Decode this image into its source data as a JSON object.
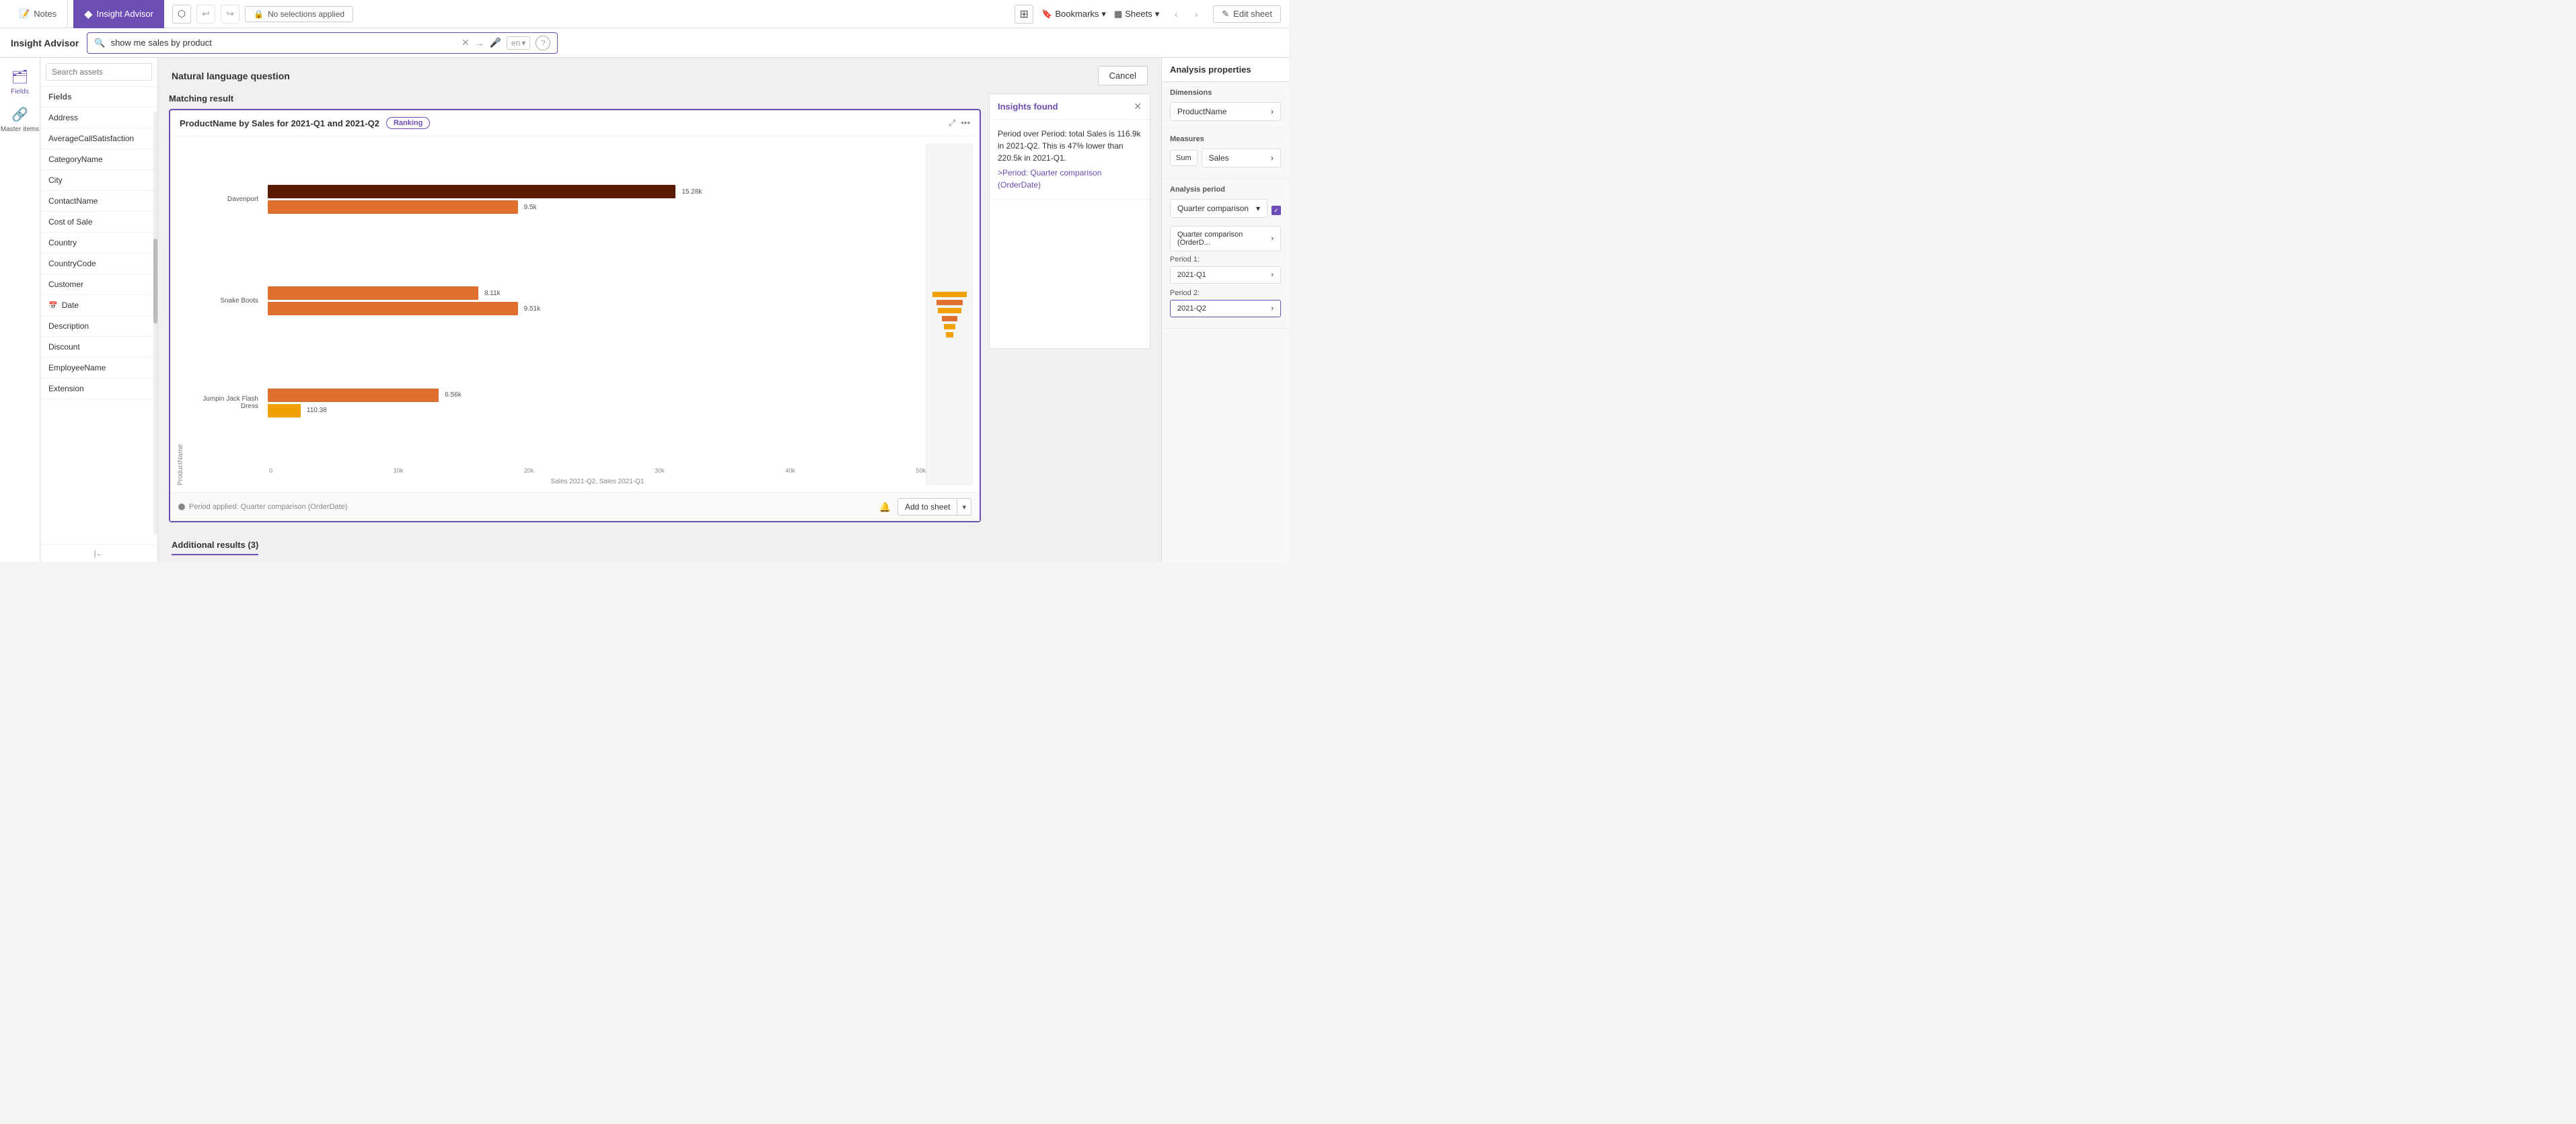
{
  "tabs": {
    "notes": "Notes",
    "insight_advisor": "Insight Advisor"
  },
  "top_bar": {
    "no_selections": "No selections applied",
    "bookmarks": "Bookmarks",
    "sheets": "Sheets",
    "edit_sheet": "Edit sheet"
  },
  "sub_header": {
    "title": "Insight Advisor",
    "search_value": "show me sales by product",
    "lang": "en",
    "lang_arrow": "▾"
  },
  "sidebar": {
    "fields_label": "Fields",
    "master_items_label": "Master items"
  },
  "fields_panel": {
    "search_placeholder": "Search assets",
    "header": "Fields",
    "items": [
      {
        "name": "Address"
      },
      {
        "name": "AverageCallSatisfaction"
      },
      {
        "name": "CategoryName"
      },
      {
        "name": "City"
      },
      {
        "name": "ContactName"
      },
      {
        "name": "Cost of Sale"
      },
      {
        "name": "Country"
      },
      {
        "name": "CountryCode"
      },
      {
        "name": "Customer"
      },
      {
        "name": "Date",
        "icon": "cal"
      },
      {
        "name": "Description"
      },
      {
        "name": "Discount"
      },
      {
        "name": "EmployeeName"
      },
      {
        "name": "Extension"
      }
    ]
  },
  "nlq": {
    "header": "Natural language question",
    "cancel_btn": "Cancel"
  },
  "chart": {
    "matching_result": "Matching result",
    "title": "ProductName by Sales for 2021-Q1 and 2021-Q2",
    "badge": "Ranking",
    "bars": [
      {
        "label": "Davenport",
        "bars": [
          {
            "value": 15.28,
            "display": "15.28k",
            "pct": 62,
            "color": "dark"
          },
          {
            "value": 9.5,
            "display": "9.5k",
            "pct": 38,
            "color": "orange"
          }
        ]
      },
      {
        "label": "Snake Boots",
        "bars": [
          {
            "value": 8.11,
            "display": "8.11k",
            "pct": 32,
            "color": "orange"
          },
          {
            "value": 9.51,
            "display": "9.51k",
            "pct": 38,
            "color": "orange"
          }
        ]
      },
      {
        "label": "Jumpin Jack Flash Dress",
        "bars": [
          {
            "value": 6.56,
            "display": "6.56k",
            "pct": 26,
            "color": "orange"
          },
          {
            "value": 110.38,
            "display": "110.38",
            "pct": 5,
            "color": "gold"
          }
        ]
      }
    ],
    "x_ticks": [
      "0",
      "10k",
      "20k",
      "30k",
      "40k",
      "50k"
    ],
    "x_axis_label": "Sales 2021-Q2, Sales 2021-Q1",
    "y_axis_label": "ProductName",
    "period_label": "Period applied:  Quarter comparison (OrderDate)",
    "add_to_sheet": "Add to sheet"
  },
  "insights": {
    "title": "Insights found",
    "text": "Period over Period: total Sales is 116.9k in 2021-Q2. This is 47% lower than 220.5k in 2021-Q1.",
    "link": ">Period: Quarter comparison (OrderDate)"
  },
  "additional_results": {
    "label": "Additional results (3)"
  },
  "right_panel": {
    "title": "Analysis properties",
    "dimensions_label": "Dimensions",
    "dimension_name": "ProductName",
    "measures_label": "Measures",
    "measure_agg": "Sum",
    "measure_name": "Sales",
    "analysis_period_label": "Analysis period",
    "period_dropdown": "Quarter comparison",
    "period_detail": "Quarter comparison (OrderD...",
    "period1_label": "Period 1:",
    "period1_value": "2021-Q1",
    "period2_label": "Period 2:",
    "period2_value": "2021-Q2"
  }
}
